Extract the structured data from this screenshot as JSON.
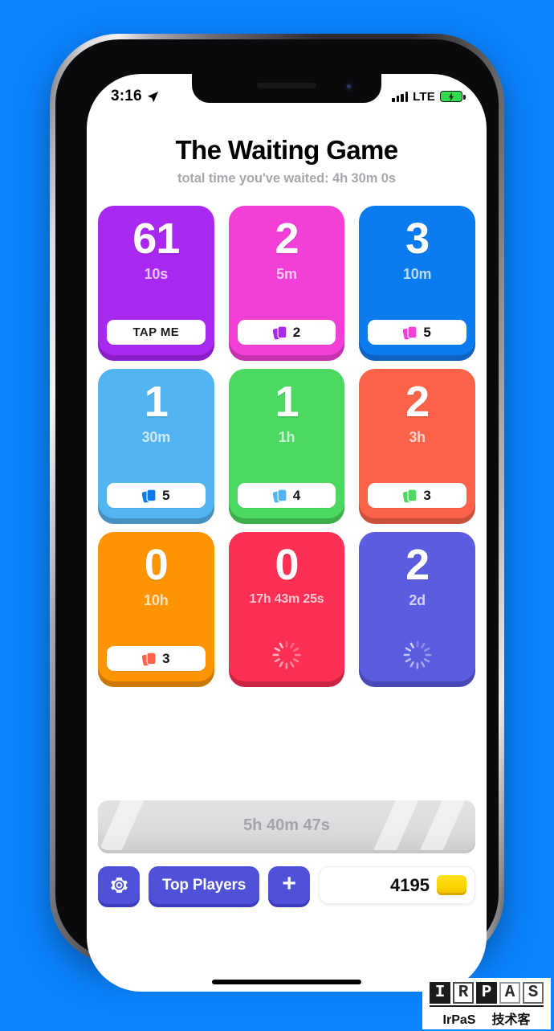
{
  "status_bar": {
    "time": "3:16",
    "location_icon": "location-arrow-icon",
    "signal_icon": "cellular-bars-icon",
    "network": "LTE",
    "battery_icon": "battery-charging-icon"
  },
  "header": {
    "title": "The Waiting Game",
    "subtitle": "total time you've waited: 4h 30m 0s"
  },
  "tiles": [
    {
      "count": "61",
      "interval": "10s",
      "action_label": "TAP ME",
      "mode": "tap",
      "color": "#a929f0",
      "shadow": "#8a1cc9",
      "icon_color": "#ffffff"
    },
    {
      "count": "2",
      "interval": "5m",
      "stack_count": "2",
      "mode": "stack",
      "color": "#f13fd8",
      "shadow": "#c432b0",
      "icon_color": "#a929f0"
    },
    {
      "count": "3",
      "interval": "10m",
      "stack_count": "5",
      "mode": "stack",
      "color": "#0a7cf0",
      "shadow": "#0c63c0",
      "icon_color": "#f13fd8"
    },
    {
      "count": "1",
      "interval": "30m",
      "stack_count": "5",
      "mode": "stack",
      "color": "#52b4f0",
      "shadow": "#4791c2",
      "icon_color": "#0a7cf0"
    },
    {
      "count": "1",
      "interval": "1h",
      "stack_count": "4",
      "mode": "stack",
      "color": "#4cd861",
      "shadow": "#3cae4e",
      "icon_color": "#52b4f0"
    },
    {
      "count": "2",
      "interval": "3h",
      "stack_count": "3",
      "mode": "stack",
      "color": "#fa6348",
      "shadow": "#c9513c",
      "icon_color": "#4cd861"
    },
    {
      "count": "0",
      "interval": "10h",
      "stack_count": "3",
      "mode": "stack",
      "color": "#fc9403",
      "shadow": "#cb7703",
      "icon_color": "#fa6348"
    },
    {
      "count": "0",
      "interval": "17h 43m 25s",
      "mode": "loading",
      "color": "#fc2f54",
      "shadow": "#c92644",
      "icon_color": "#ffffff"
    },
    {
      "count": "2",
      "interval": "2d",
      "mode": "loading",
      "color": "#5b5ce0",
      "shadow": "#4849b5",
      "icon_color": "#ffffff"
    }
  ],
  "locked_bar": {
    "label": "5h 40m 47s"
  },
  "bottom_bar": {
    "settings_icon": "gear-icon",
    "top_players_label": "Top Players",
    "add_label": "+",
    "coin_count": "4195",
    "coin_icon": "gold-coin-icon"
  },
  "watermark": {
    "blocks": [
      "I",
      "R",
      "P",
      "A",
      "S"
    ],
    "name": "IrPaS",
    "tagline": "技术客"
  },
  "colors": {
    "background": "#0b84fe",
    "accent": "#4f51d8",
    "screen": "#ffffff"
  }
}
